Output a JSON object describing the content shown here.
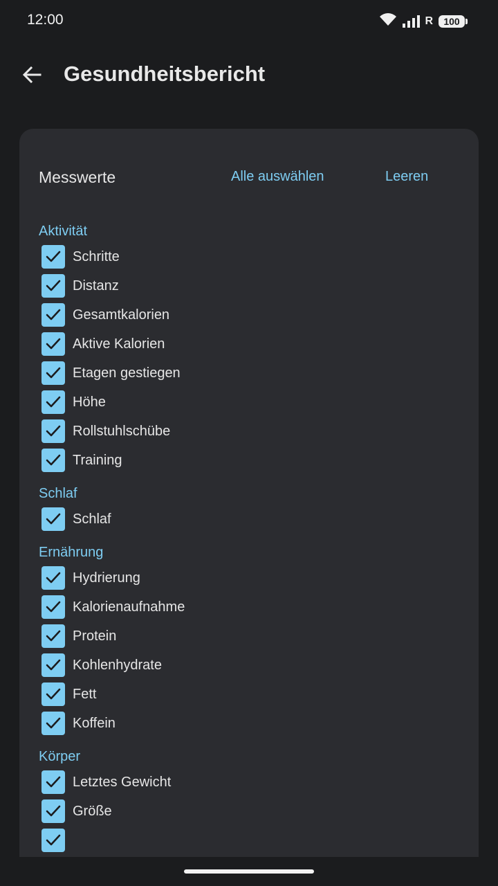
{
  "status_bar": {
    "time": "12:00",
    "signal_label": "R",
    "battery": "100",
    "icons": [
      "wifi-icon",
      "signal-icon",
      "battery-icon"
    ]
  },
  "app_bar": {
    "back_icon": "arrow-back-icon",
    "title": "Gesundheitsbericht"
  },
  "card": {
    "title": "Messwerte",
    "select_all": "Alle auswählen",
    "clear": "Leeren"
  },
  "groups": [
    {
      "label": "Aktivität",
      "items": [
        {
          "label": "Schritte",
          "checked": true
        },
        {
          "label": "Distanz",
          "checked": true
        },
        {
          "label": "Gesamtkalorien",
          "checked": true
        },
        {
          "label": "Aktive Kalorien",
          "checked": true
        },
        {
          "label": "Etagen gestiegen",
          "checked": true
        },
        {
          "label": "Höhe",
          "checked": true
        },
        {
          "label": "Rollstuhlschübe",
          "checked": true
        },
        {
          "label": "Training",
          "checked": true
        }
      ]
    },
    {
      "label": "Schlaf",
      "items": [
        {
          "label": "Schlaf",
          "checked": true
        }
      ]
    },
    {
      "label": "Ernährung",
      "items": [
        {
          "label": "Hydrierung",
          "checked": true
        },
        {
          "label": "Kalorienaufnahme",
          "checked": true
        },
        {
          "label": "Protein",
          "checked": true
        },
        {
          "label": "Kohlenhydrate",
          "checked": true
        },
        {
          "label": "Fett",
          "checked": true
        },
        {
          "label": "Koffein",
          "checked": true
        }
      ]
    },
    {
      "label": "Körper",
      "items": [
        {
          "label": "Letztes Gewicht",
          "checked": true
        },
        {
          "label": "Größe",
          "checked": true
        },
        {
          "label": "",
          "checked": true
        }
      ]
    }
  ],
  "colors": {
    "background": "#1b1c1e",
    "card": "#2b2c30",
    "accent": "#7ecdf2",
    "text": "#e6e6e6"
  }
}
